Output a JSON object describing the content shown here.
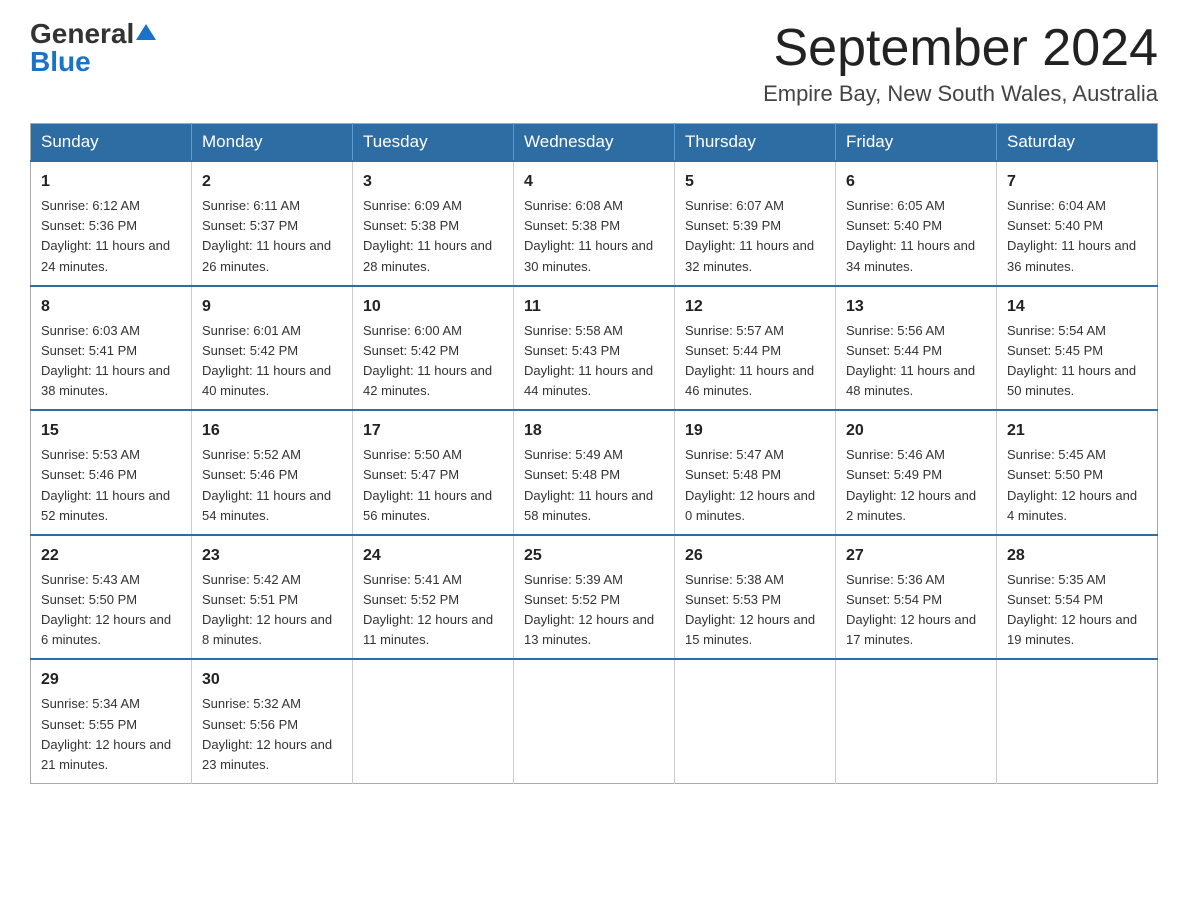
{
  "logo": {
    "general": "General",
    "blue": "Blue"
  },
  "title": {
    "month_year": "September 2024",
    "location": "Empire Bay, New South Wales, Australia"
  },
  "header": {
    "days": [
      "Sunday",
      "Monday",
      "Tuesday",
      "Wednesday",
      "Thursday",
      "Friday",
      "Saturday"
    ]
  },
  "weeks": [
    [
      {
        "day": "1",
        "sunrise": "6:12 AM",
        "sunset": "5:36 PM",
        "daylight": "11 hours and 24 minutes."
      },
      {
        "day": "2",
        "sunrise": "6:11 AM",
        "sunset": "5:37 PM",
        "daylight": "11 hours and 26 minutes."
      },
      {
        "day": "3",
        "sunrise": "6:09 AM",
        "sunset": "5:38 PM",
        "daylight": "11 hours and 28 minutes."
      },
      {
        "day": "4",
        "sunrise": "6:08 AM",
        "sunset": "5:38 PM",
        "daylight": "11 hours and 30 minutes."
      },
      {
        "day": "5",
        "sunrise": "6:07 AM",
        "sunset": "5:39 PM",
        "daylight": "11 hours and 32 minutes."
      },
      {
        "day": "6",
        "sunrise": "6:05 AM",
        "sunset": "5:40 PM",
        "daylight": "11 hours and 34 minutes."
      },
      {
        "day": "7",
        "sunrise": "6:04 AM",
        "sunset": "5:40 PM",
        "daylight": "11 hours and 36 minutes."
      }
    ],
    [
      {
        "day": "8",
        "sunrise": "6:03 AM",
        "sunset": "5:41 PM",
        "daylight": "11 hours and 38 minutes."
      },
      {
        "day": "9",
        "sunrise": "6:01 AM",
        "sunset": "5:42 PM",
        "daylight": "11 hours and 40 minutes."
      },
      {
        "day": "10",
        "sunrise": "6:00 AM",
        "sunset": "5:42 PM",
        "daylight": "11 hours and 42 minutes."
      },
      {
        "day": "11",
        "sunrise": "5:58 AM",
        "sunset": "5:43 PM",
        "daylight": "11 hours and 44 minutes."
      },
      {
        "day": "12",
        "sunrise": "5:57 AM",
        "sunset": "5:44 PM",
        "daylight": "11 hours and 46 minutes."
      },
      {
        "day": "13",
        "sunrise": "5:56 AM",
        "sunset": "5:44 PM",
        "daylight": "11 hours and 48 minutes."
      },
      {
        "day": "14",
        "sunrise": "5:54 AM",
        "sunset": "5:45 PM",
        "daylight": "11 hours and 50 minutes."
      }
    ],
    [
      {
        "day": "15",
        "sunrise": "5:53 AM",
        "sunset": "5:46 PM",
        "daylight": "11 hours and 52 minutes."
      },
      {
        "day": "16",
        "sunrise": "5:52 AM",
        "sunset": "5:46 PM",
        "daylight": "11 hours and 54 minutes."
      },
      {
        "day": "17",
        "sunrise": "5:50 AM",
        "sunset": "5:47 PM",
        "daylight": "11 hours and 56 minutes."
      },
      {
        "day": "18",
        "sunrise": "5:49 AM",
        "sunset": "5:48 PM",
        "daylight": "11 hours and 58 minutes."
      },
      {
        "day": "19",
        "sunrise": "5:47 AM",
        "sunset": "5:48 PM",
        "daylight": "12 hours and 0 minutes."
      },
      {
        "day": "20",
        "sunrise": "5:46 AM",
        "sunset": "5:49 PM",
        "daylight": "12 hours and 2 minutes."
      },
      {
        "day": "21",
        "sunrise": "5:45 AM",
        "sunset": "5:50 PM",
        "daylight": "12 hours and 4 minutes."
      }
    ],
    [
      {
        "day": "22",
        "sunrise": "5:43 AM",
        "sunset": "5:50 PM",
        "daylight": "12 hours and 6 minutes."
      },
      {
        "day": "23",
        "sunrise": "5:42 AM",
        "sunset": "5:51 PM",
        "daylight": "12 hours and 8 minutes."
      },
      {
        "day": "24",
        "sunrise": "5:41 AM",
        "sunset": "5:52 PM",
        "daylight": "12 hours and 11 minutes."
      },
      {
        "day": "25",
        "sunrise": "5:39 AM",
        "sunset": "5:52 PM",
        "daylight": "12 hours and 13 minutes."
      },
      {
        "day": "26",
        "sunrise": "5:38 AM",
        "sunset": "5:53 PM",
        "daylight": "12 hours and 15 minutes."
      },
      {
        "day": "27",
        "sunrise": "5:36 AM",
        "sunset": "5:54 PM",
        "daylight": "12 hours and 17 minutes."
      },
      {
        "day": "28",
        "sunrise": "5:35 AM",
        "sunset": "5:54 PM",
        "daylight": "12 hours and 19 minutes."
      }
    ],
    [
      {
        "day": "29",
        "sunrise": "5:34 AM",
        "sunset": "5:55 PM",
        "daylight": "12 hours and 21 minutes."
      },
      {
        "day": "30",
        "sunrise": "5:32 AM",
        "sunset": "5:56 PM",
        "daylight": "12 hours and 23 minutes."
      },
      null,
      null,
      null,
      null,
      null
    ]
  ],
  "labels": {
    "sunrise": "Sunrise: ",
    "sunset": "Sunset: ",
    "daylight": "Daylight: "
  }
}
